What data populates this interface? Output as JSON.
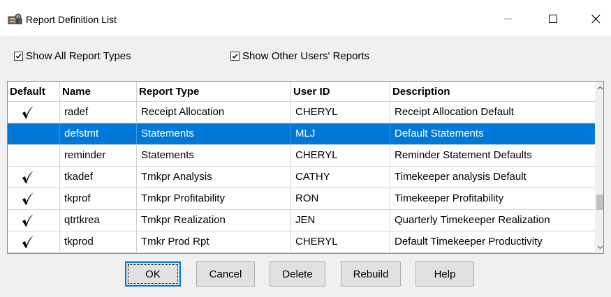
{
  "window": {
    "title": "Report Definition List",
    "icon": "report-cabinet-icon"
  },
  "options": {
    "show_all_types": {
      "label": "Show All Report Types",
      "checked": true
    },
    "show_other_users": {
      "label": "Show Other Users' Reports",
      "checked": true
    }
  },
  "table": {
    "columns": [
      "Default",
      "Name",
      "Report Type",
      "User ID",
      "Description"
    ],
    "rows": [
      {
        "default": true,
        "name": "radef",
        "type": "Receipt Allocation",
        "user": "CHERYL",
        "desc": "Receipt Allocation Default"
      },
      {
        "default": false,
        "name": "defstmt",
        "type": "Statements",
        "user": "MLJ",
        "desc": "Default Statements",
        "selected": true
      },
      {
        "default": false,
        "name": "reminder",
        "type": "Statements",
        "user": "CHERYL",
        "desc": "Reminder Statement Defaults"
      },
      {
        "default": true,
        "name": "tkadef",
        "type": "Tmkpr Analysis",
        "user": "CATHY",
        "desc": "Timekeeper analysis Default"
      },
      {
        "default": true,
        "name": "tkprof",
        "type": "Tmkpr Profitability",
        "user": "RON",
        "desc": "Timekeeper Profitability"
      },
      {
        "default": true,
        "name": "qtrtkrea",
        "type": "Tmkpr Realization",
        "user": "JEN",
        "desc": "Quarterly Timekeeper Realization"
      },
      {
        "default": true,
        "name": "tkprod",
        "type": "Tmkr Prod Rpt",
        "user": "CHERYL",
        "desc": "Default Timekeeper Productivity"
      }
    ]
  },
  "buttons": {
    "ok": "OK",
    "cancel": "Cancel",
    "delete": "Delete",
    "rebuild": "Rebuild",
    "help": "Help"
  },
  "colors": {
    "selection": "#0078d7",
    "window_bg": "#f0f0f0"
  }
}
